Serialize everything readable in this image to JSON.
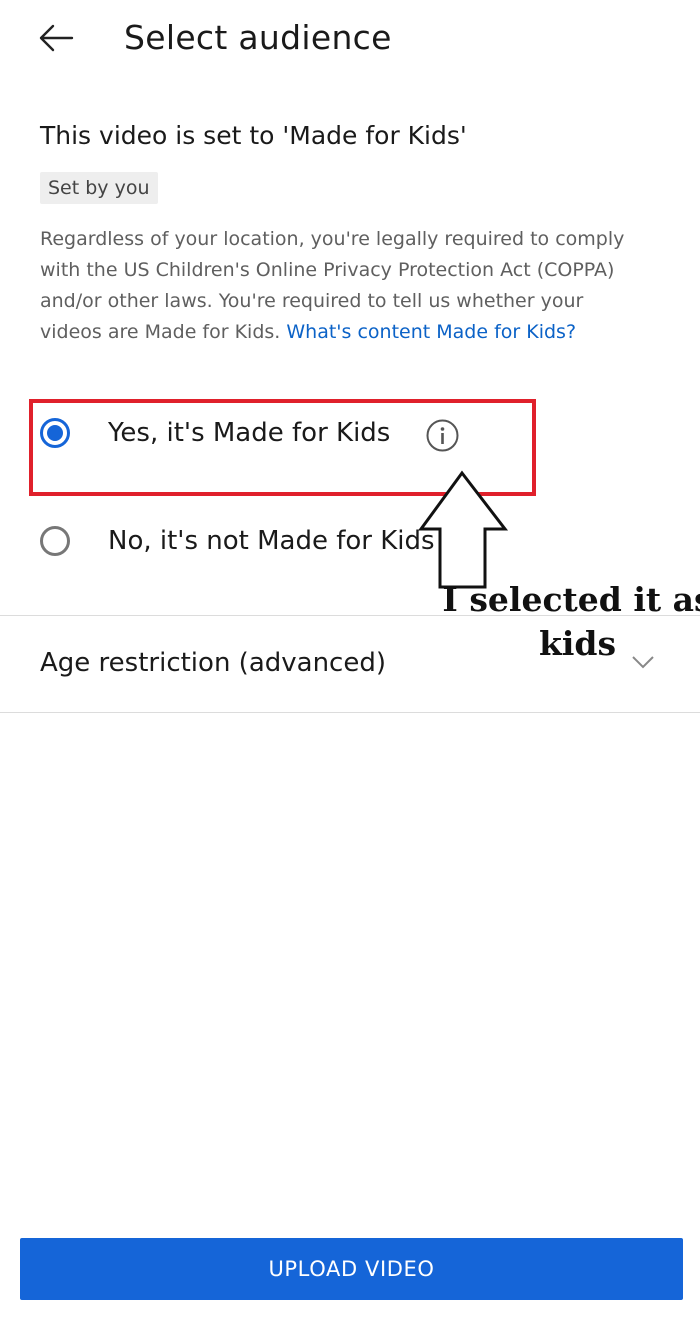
{
  "header": {
    "title": "Select audience",
    "back_icon": "arrow-left-icon"
  },
  "status": {
    "title": "This video is set to 'Made for Kids'",
    "chip": "Set by you",
    "description_lines": [
      "Regardless of your location, you're legally required to comply",
      "with the US Children's Online Privacy Protection Act (COPPA)",
      "and/or other laws. You're required to tell us whether your"
    ],
    "description_last_prefix": "videos are Made for Kids.",
    "link_text": "What's content Made for Kids?"
  },
  "options": {
    "yes": {
      "label": "Yes, it's Made for Kids",
      "selected": true,
      "icon": "info-icon"
    },
    "no": {
      "label": "No, it's not Made for Kids",
      "selected": false
    }
  },
  "age_restriction": {
    "label": "Age restriction (advanced)",
    "icon": "chevron-down-icon"
  },
  "upload": {
    "label": "UPLOAD VIDEO"
  },
  "annotation": {
    "text_line1": "I selected it as",
    "text_line2": "kids"
  },
  "colors": {
    "accent": "#1565d8",
    "link": "#0b62c7",
    "highlight": "#e0202b"
  }
}
